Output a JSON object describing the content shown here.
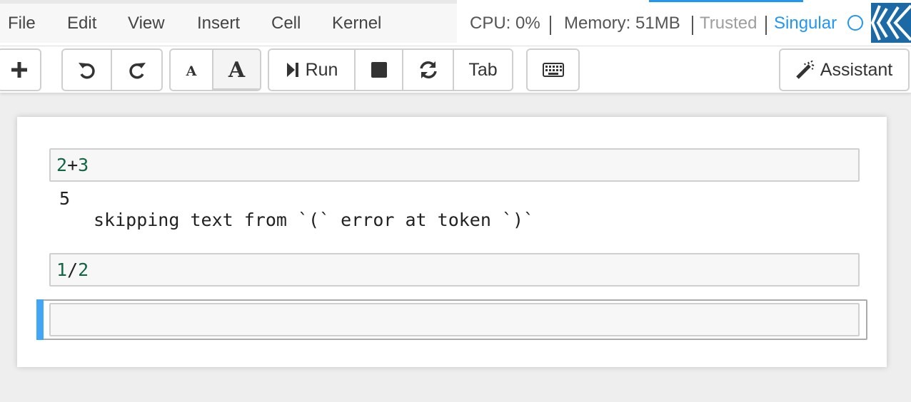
{
  "menu": {
    "items": [
      "File",
      "Edit",
      "View",
      "Insert",
      "Cell",
      "Kernel"
    ]
  },
  "status": {
    "cpu": "CPU: 0%",
    "memory": "Memory: 51MB",
    "trusted": "Trusted",
    "kernel_name": "Singular",
    "kernel_state_icon": "circle-idle-icon",
    "accent_color": "#2196f3"
  },
  "toolbar": {
    "insert_icon": "plus-icon",
    "undo_icon": "undo-icon",
    "redo_icon": "redo-icon",
    "font_small_label": "A",
    "font_large_label": "A",
    "run_label": "Run",
    "stop_icon": "stop-icon",
    "restart_icon": "restart-icon",
    "tab_label": "Tab",
    "keyboard_icon": "keyboard-icon",
    "assistant_label": "Assistant",
    "assistant_icon": "magic-wand-icon"
  },
  "cells": {
    "c1": {
      "a": "2",
      "op": "+",
      "b": "3"
    },
    "c1_output": "5",
    "c1_message": "skipping text from `(` error at token `)`",
    "c2": {
      "a": "1",
      "op": "/",
      "b": "2"
    },
    "c3": ""
  },
  "colors": {
    "code_number": "#116644",
    "selected_cell_bar": "#42a5f5"
  }
}
